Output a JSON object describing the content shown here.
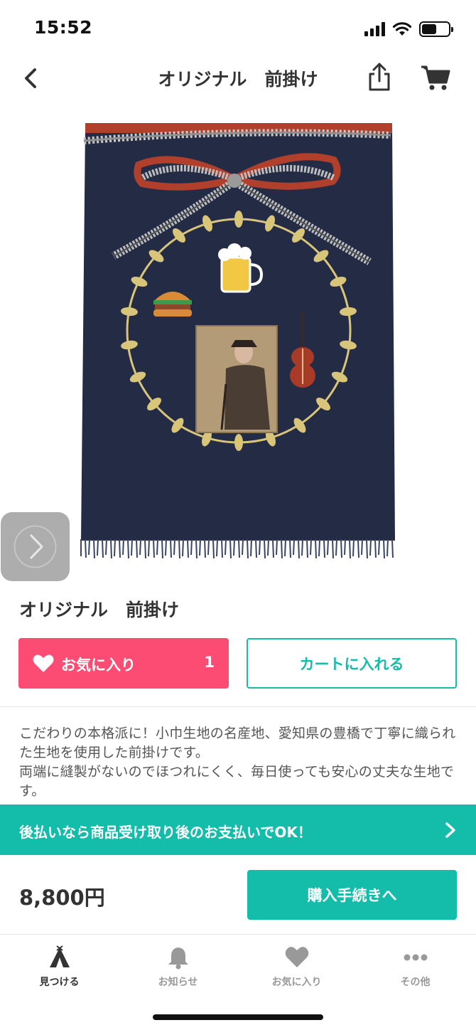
{
  "status_bar": {
    "time": "15:52",
    "battery_level": 0.55
  },
  "nav": {
    "title": "オリジナル　前掛け",
    "icons": [
      "back-icon",
      "share-icon",
      "cart-icon"
    ]
  },
  "product": {
    "title": "オリジナル　前掛け",
    "image_icons": [
      "beer-mug-icon",
      "hamburger-icon",
      "violin-icon",
      "laurel-wreath-icon",
      "portrait-photo"
    ],
    "colors": {
      "apron": "#242c45",
      "wreath": "#d9c57a",
      "string_red": "#b0402c"
    }
  },
  "actions": {
    "favorite_label": "お気に入り",
    "favorite_count": "1",
    "add_to_cart_label": "カートに入れる"
  },
  "description": "こだわりの本格派に！小巾生地の名産地、愛知県の豊橋で丁寧に織られた生地を使用した前掛けです。\n両端に縫製がないのでほつれにくく、毎日使っても安心の丈夫な生地です。",
  "payment_banner": {
    "text": "後払いなら商品受け取り後のお支払いでOK！"
  },
  "purchase": {
    "price": "8,800円",
    "buy_label": "購入手続きへ"
  },
  "tab_bar": {
    "tabs": [
      {
        "label": "見つける",
        "icon": "tent-icon",
        "active": true
      },
      {
        "label": "お知らせ",
        "icon": "bell-icon",
        "active": false
      },
      {
        "label": "お気に入り",
        "icon": "heart-icon",
        "active": false
      },
      {
        "label": "その他",
        "icon": "more-icon",
        "active": false
      }
    ]
  },
  "colors": {
    "accent": "#14bcaa",
    "favorite": "#fc4c73"
  }
}
